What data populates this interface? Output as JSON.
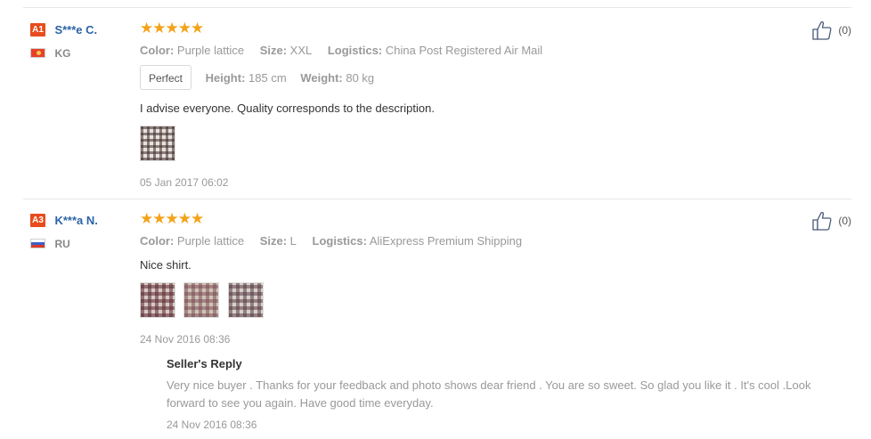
{
  "reviews": [
    {
      "level": "A1",
      "name": "S***e C.",
      "country": "KG",
      "stars": "★★★★★",
      "color_label": "Color:",
      "color": "Purple lattice",
      "size_label": "Size:",
      "size": "XXL",
      "logistics_label": "Logistics:",
      "logistics": "China Post Registered Air Mail",
      "fit": "Perfect",
      "height_label": "Height:",
      "height": "185 cm",
      "weight_label": "Weight:",
      "weight": "80 kg",
      "text": "I advise everyone. Quality corresponds to the description.",
      "date": "05 Jan 2017 06:02",
      "helpful_count": "(0)"
    },
    {
      "level": "A3",
      "name": "K***a N.",
      "country": "RU",
      "stars": "★★★★★",
      "color_label": "Color:",
      "color": "Purple lattice",
      "size_label": "Size:",
      "size": "L",
      "logistics_label": "Logistics:",
      "logistics": "AliExpress Premium Shipping",
      "text": "Nice shirt.",
      "date": "24 Nov 2016 08:36",
      "helpful_count": "(0)",
      "reply": {
        "title": "Seller's Reply",
        "text": "Very nice buyer . Thanks for your feedback and photo shows dear friend . You are so sweet. So glad you like it . It's cool .Look forward to see you again. Have good time everyday.",
        "date": "24 Nov 2016 08:36"
      }
    }
  ],
  "colors": {
    "star": "#f3a319",
    "username": "#2b63a6",
    "level_badge": "#e74c1c",
    "muted_text": "#999999"
  },
  "icons": {
    "helpful": "thumbs-up-icon",
    "flag_kg": "flag-kg-icon",
    "flag_ru": "flag-ru-icon"
  }
}
